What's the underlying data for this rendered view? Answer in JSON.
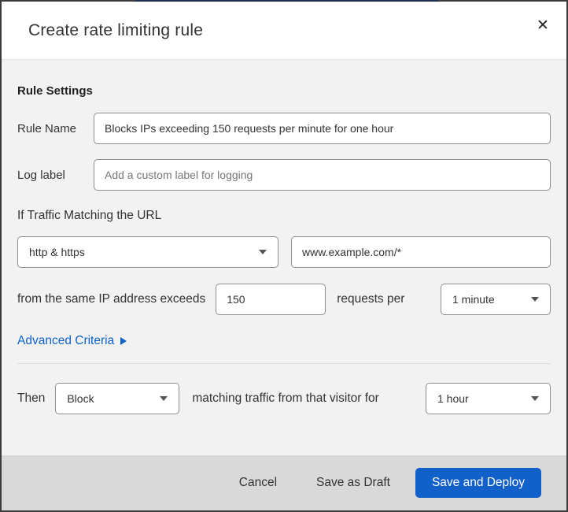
{
  "dialog": {
    "title": "Create rate limiting rule",
    "close_glyph": "✕"
  },
  "rule_settings": {
    "heading": "Rule Settings",
    "rule_name": {
      "label": "Rule Name",
      "value": "Blocks IPs exceeding 150 requests per minute for one hour"
    },
    "log_label": {
      "label": "Log label",
      "placeholder": "Add a custom label for logging"
    },
    "match": {
      "intro": "If Traffic Matching the URL",
      "scheme_selected": "http & https",
      "url_value": "www.example.com/*"
    },
    "threshold": {
      "prefix": "from the same IP address exceeds",
      "count_value": "150",
      "middle": "requests per",
      "period_selected": "1 minute"
    },
    "advanced_label": "Advanced Criteria",
    "action": {
      "prefix": "Then",
      "action_selected": "Block",
      "middle": "matching traffic from that visitor for",
      "duration_selected": "1 hour"
    }
  },
  "footer": {
    "cancel_label": "Cancel",
    "save_draft_label": "Save as Draft",
    "save_deploy_label": "Save and Deploy"
  },
  "colors": {
    "accent_blue": "#0e62c8",
    "deploy_button": "#1261cb",
    "body_bg": "#f2f2f2",
    "footer_bg": "#d9d9d9"
  }
}
